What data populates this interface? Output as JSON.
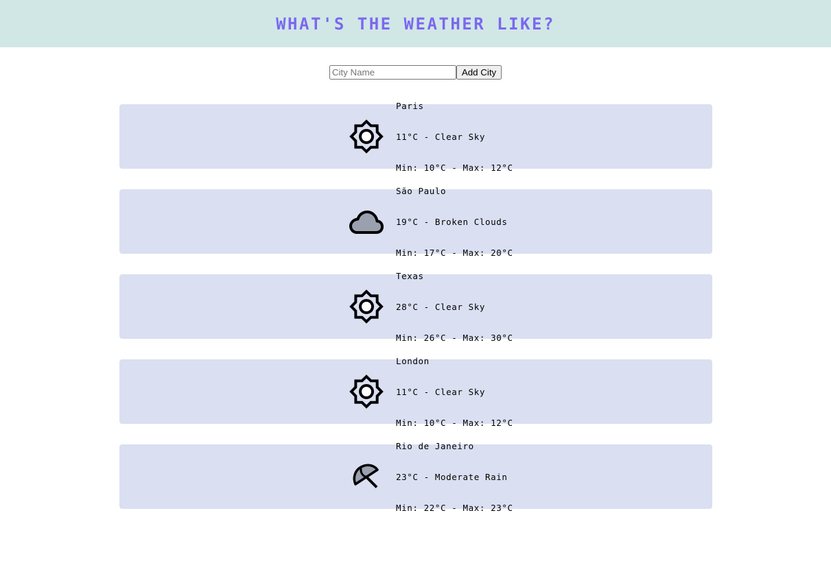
{
  "header": {
    "title": "WHAT'S THE WEATHER LIKE?"
  },
  "form": {
    "input_placeholder": "City Name",
    "input_value": "",
    "add_button_label": "Add City"
  },
  "colors": {
    "accent": "#7b68ee",
    "header_bg": "#d1e7e6",
    "card_bg": "#dadff1"
  },
  "cities": [
    {
      "name": "Paris",
      "condition": "11°C - Clear Sky",
      "range": "Min: 10°C - Max: 12°C",
      "icon": "sun-icon"
    },
    {
      "name": "São Paulo",
      "condition": "19°C - Broken Clouds",
      "range": "Min: 17°C - Max: 20°C",
      "icon": "cloud-icon"
    },
    {
      "name": "Texas",
      "condition": "28°C - Clear Sky",
      "range": "Min: 26°C - Max: 30°C",
      "icon": "sun-icon"
    },
    {
      "name": "London",
      "condition": "11°C - Clear Sky",
      "range": "Min: 10°C - Max: 12°C",
      "icon": "sun-icon"
    },
    {
      "name": "Rio de Janeiro",
      "condition": "23°C - Moderate Rain",
      "range": "Min: 22°C - Max: 23°C",
      "icon": "umbrella-icon"
    }
  ]
}
